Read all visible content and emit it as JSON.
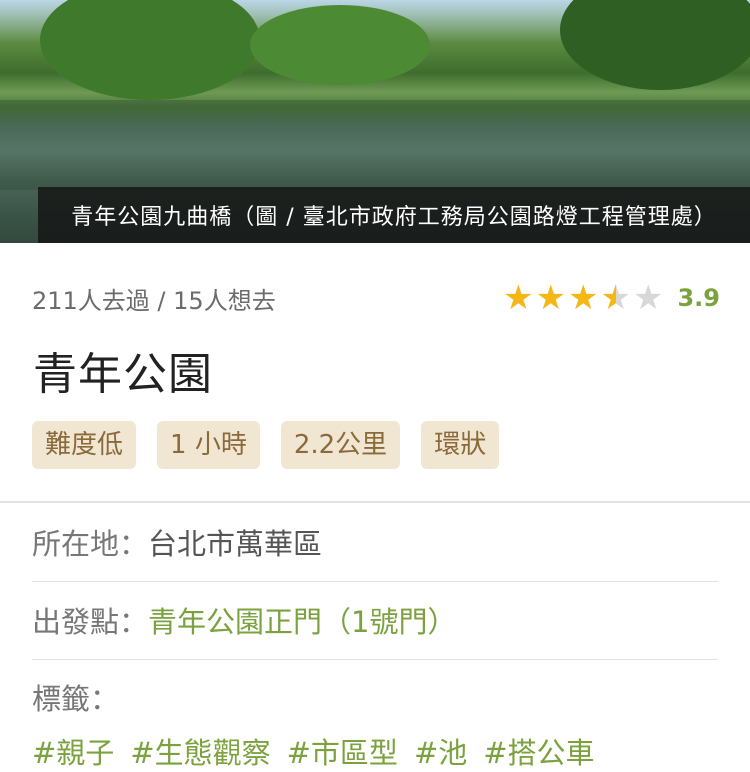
{
  "hero": {
    "caption": "青年公園九曲橋（圖 / 臺北市政府工務局公園路燈工程管理處）"
  },
  "stats": {
    "visited_text": "211人去過 / 15人想去",
    "rating_value": 3.9,
    "rating_label": "3.9",
    "stars_max": 5
  },
  "title": "青年公園",
  "badges": [
    "難度低",
    "1 小時",
    "2.2公里",
    "環狀"
  ],
  "info": {
    "location_label": "所在地：",
    "location_value": "台北市萬華區",
    "start_label": "出發點：",
    "start_value": "青年公園正門（1號門）",
    "tags_label": "標籤："
  },
  "tags": [
    "#親子",
    "#生態觀察",
    "#市區型",
    "#池",
    "#搭公車"
  ],
  "colors": {
    "accent_green": "#7ba23f",
    "star_gold": "#f5b716",
    "badge_bg": "#f1e6d2",
    "badge_text": "#8a6a3b"
  }
}
